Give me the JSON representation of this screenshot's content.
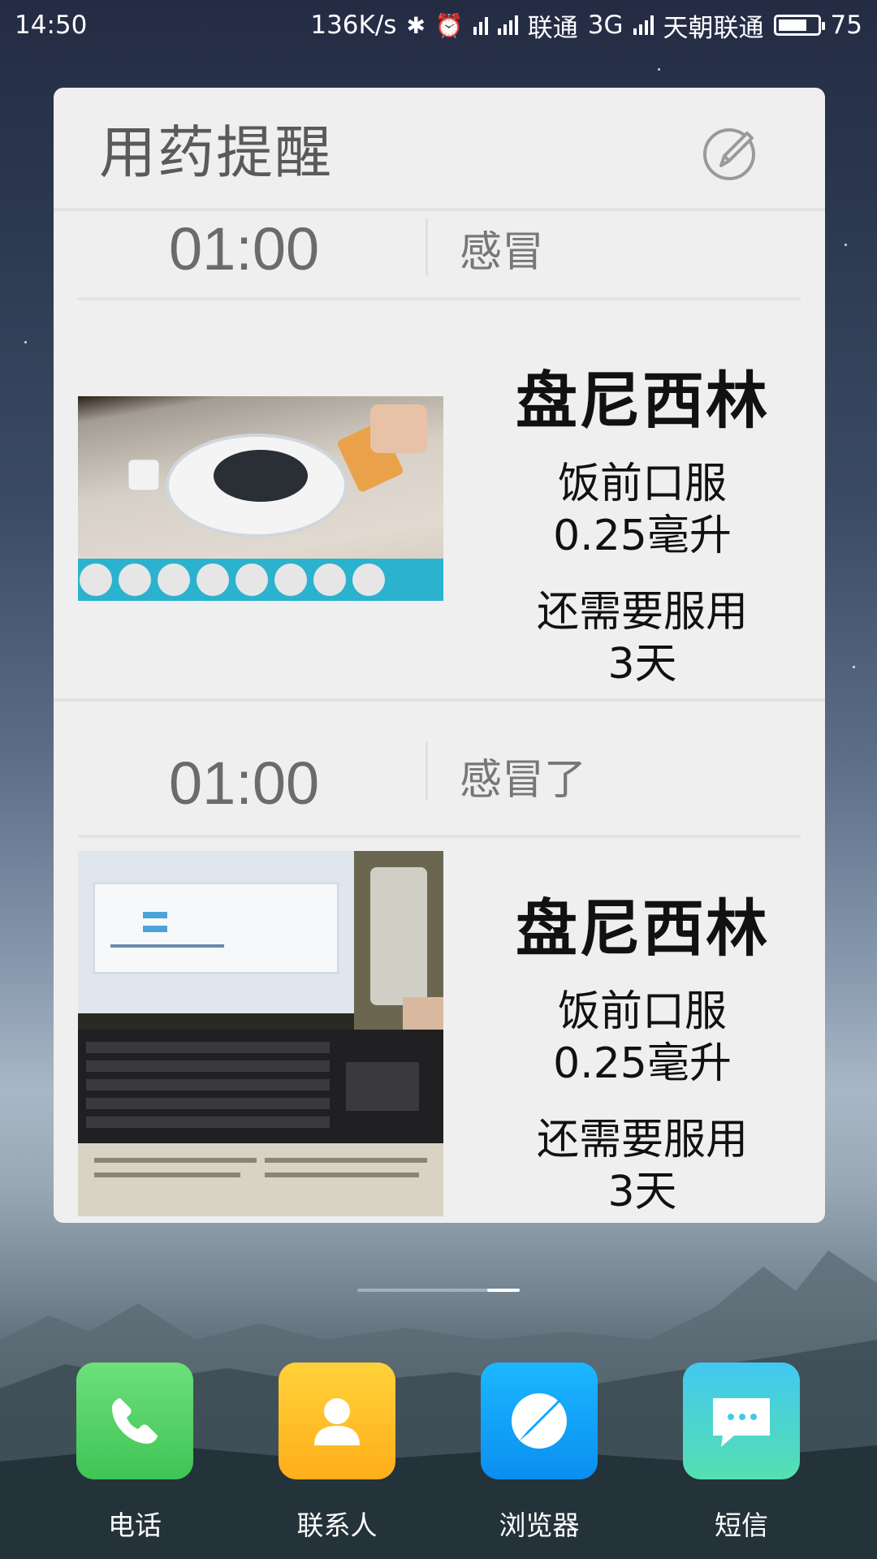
{
  "status_bar": {
    "time": "14:50",
    "net_speed": "136K/s",
    "carrier1": "联通",
    "network_type": "3G",
    "carrier2": "天朝联通",
    "battery": "75"
  },
  "widget": {
    "title": "用药提醒",
    "entries": [
      {
        "time": "01:00",
        "name": "感冒",
        "drug": "盘尼西林",
        "method": "饭前口服",
        "dose": "0.25毫升",
        "remaining_label": "还需要服用",
        "remaining_days": "3天"
      },
      {
        "time": "01:00",
        "name": "感冒了",
        "drug": "盘尼西林",
        "method": "饭前口服",
        "dose": "0.25毫升",
        "remaining_label": "还需要服用",
        "remaining_days": "3天"
      }
    ]
  },
  "dock": [
    {
      "label": "电话",
      "icon": "phone-icon",
      "color": "#4cd964"
    },
    {
      "label": "联系人",
      "icon": "contacts-icon",
      "color": "#ffb81e"
    },
    {
      "label": "浏览器",
      "icon": "browser-icon",
      "color": "#0aa6ff"
    },
    {
      "label": "短信",
      "icon": "message-icon",
      "color": "#3fd3c8"
    }
  ]
}
